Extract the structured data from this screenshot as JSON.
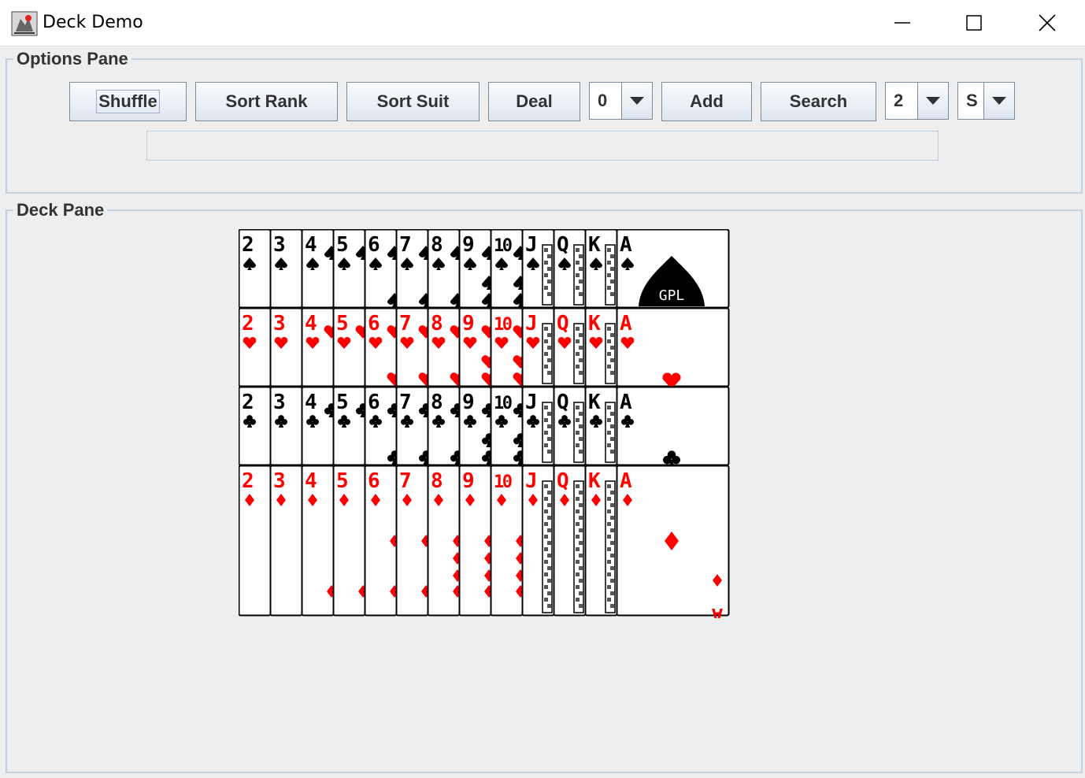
{
  "window": {
    "title": "Deck Demo",
    "controls": {
      "minimize": "minimize-icon",
      "maximize": "maximize-icon",
      "close": "close-icon"
    }
  },
  "options_pane": {
    "title": "Options Pane",
    "buttons": {
      "shuffle": "Shuffle",
      "sort_rank": "Sort Rank",
      "sort_suit": "Sort Suit",
      "deal": "Deal",
      "add": "Add",
      "search": "Search"
    },
    "deal_count": "0",
    "search_rank": "2",
    "search_suit": "S",
    "status_text": ""
  },
  "deck_pane": {
    "title": "Deck Pane",
    "ranks": [
      "2",
      "3",
      "4",
      "5",
      "6",
      "7",
      "8",
      "9",
      "10",
      "J",
      "Q",
      "K",
      "A"
    ],
    "suits": [
      {
        "name": "spades",
        "color": "#000000"
      },
      {
        "name": "hearts",
        "color": "#ff0000"
      },
      {
        "name": "clubs",
        "color": "#000000"
      },
      {
        "name": "diamonds",
        "color": "#ff0000"
      }
    ],
    "ace_of_spades_mark": "GPL"
  }
}
